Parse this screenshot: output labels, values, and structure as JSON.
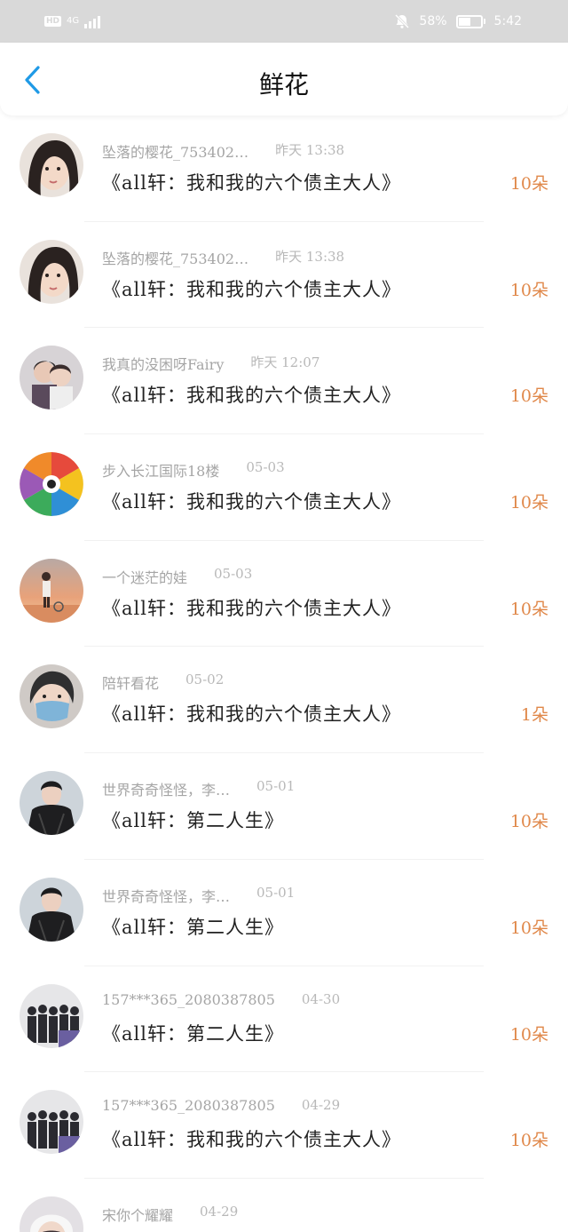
{
  "status_bar": {
    "hd": "HD",
    "network": "4G",
    "battery": "58%",
    "time": "5:42",
    "battery_level": 0.58
  },
  "header": {
    "title": "鲜花"
  },
  "colors": {
    "accent_blue": "#1f9ae6",
    "count_orange": "#e0884a"
  },
  "items": [
    {
      "user": "坠落的樱花_753402…",
      "time": "昨天 13:38",
      "book": "《all轩：我和我的六个债主大人》",
      "count": "10朵",
      "avatar": "girl-portrait"
    },
    {
      "user": "坠落的樱花_753402…",
      "time": "昨天 13:38",
      "book": "《all轩：我和我的六个债主大人》",
      "count": "10朵",
      "avatar": "girl-portrait"
    },
    {
      "user": "我真的没困呀Fairy",
      "time": "昨天 12:07",
      "book": "《all轩：我和我的六个债主大人》",
      "count": "10朵",
      "avatar": "two-boys"
    },
    {
      "user": "步入长江国际18楼",
      "time": "05-03",
      "book": "《all轩：我和我的六个债主大人》",
      "count": "10朵",
      "avatar": "colorful-wheel"
    },
    {
      "user": "一个迷茫的娃",
      "time": "05-03",
      "book": "《all轩：我和我的六个债主大人》",
      "count": "10朵",
      "avatar": "sunset-person"
    },
    {
      "user": "陪轩看花",
      "time": "05-02",
      "book": "《all轩：我和我的六个债主大人》",
      "count": "1朵",
      "avatar": "masked-boy"
    },
    {
      "user": "世界奇奇怪怪，李…",
      "time": "05-01",
      "book": "《all轩：第二人生》",
      "count": "10朵",
      "avatar": "black-outfit"
    },
    {
      "user": "世界奇奇怪怪，李…",
      "time": "05-01",
      "book": "《all轩：第二人生》",
      "count": "10朵",
      "avatar": "black-outfit"
    },
    {
      "user": "157***365_2080387805",
      "time": "04-30",
      "book": "《all轩：第二人生》",
      "count": "10朵",
      "avatar": "group-photo"
    },
    {
      "user": "157***365_2080387805",
      "time": "04-29",
      "book": "《all轩：我和我的六个债主大人》",
      "count": "10朵",
      "avatar": "group-photo"
    },
    {
      "user": "宋你个耀耀",
      "time": "04-29",
      "book": "",
      "count": "",
      "avatar": "white-hat"
    }
  ]
}
